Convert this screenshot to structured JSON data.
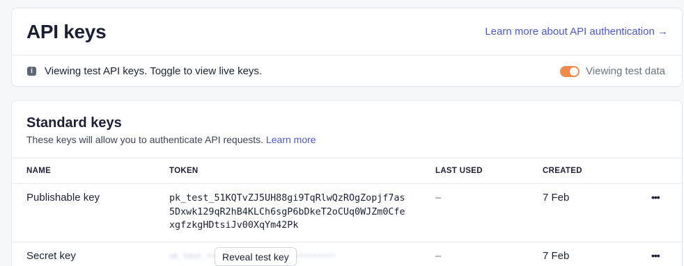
{
  "header": {
    "title": "API keys",
    "learn_link": "Learn more about API authentication →"
  },
  "info_bar": {
    "icon": "info-icon",
    "text": "Viewing test API keys. Toggle to view live keys.",
    "toggle_label": "Viewing test data",
    "toggle_on": true,
    "toggle_color": "#f08a4b"
  },
  "standard_keys": {
    "title": "Standard keys",
    "subtitle": "These keys will allow you to authenticate API requests.",
    "learn_more": "Learn more",
    "columns": {
      "name": "NAME",
      "token": "TOKEN",
      "last_used": "LAST USED",
      "created": "CREATED"
    },
    "rows": [
      {
        "name": "Publishable key",
        "token": "pk_test_51KQTvZJ5UH88gi9TqRlwQzROgZopjf7as\n5Dxwk129qR2hB4KLCh6sgP6bDkeT2oCUq0WJZm0Cfe\nxgfzkgHDtsiJv00XqYm42Pk",
        "last_used": "–",
        "created": "7 Feb",
        "more": "•••"
      },
      {
        "name": "Secret key",
        "reveal_label": "Reveal test key",
        "last_used": "–",
        "created": "7 Feb",
        "more": "•••"
      }
    ]
  },
  "colors": {
    "link": "#4b56c6",
    "text": "#1a1f36",
    "muted": "#6a7383",
    "border": "#e3e6ec"
  }
}
